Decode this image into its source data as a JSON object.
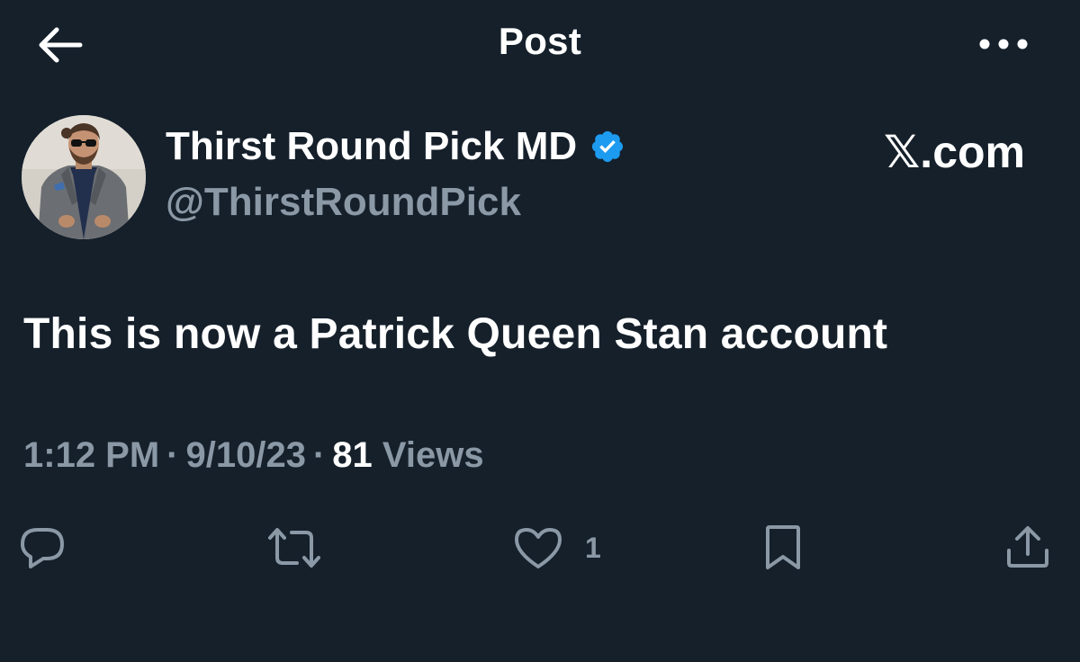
{
  "header": {
    "title": "Post",
    "back_icon": "arrow-left-icon",
    "more_icon": "more-horizontal-icon"
  },
  "author": {
    "name": "Thirst Round Pick MD",
    "handle": "@ThirstRoundPick",
    "verified_icon": "verified-badge-icon",
    "verified_color": "#1d9bf0"
  },
  "watermark": {
    "x_glyph": "𝕏",
    "domain": ".com"
  },
  "post": {
    "text": "This is now a Patrick Queen Stan account",
    "time": "1:12 PM",
    "date": "9/10/23",
    "separator": "·",
    "views_count": "81",
    "views_label": "Views"
  },
  "actions": {
    "reply_icon": "reply-icon",
    "repost_icon": "repost-icon",
    "like_icon": "heart-icon",
    "like_count": "1",
    "bookmark_icon": "bookmark-icon",
    "share_icon": "share-icon"
  },
  "colors": {
    "background": "#15202b",
    "text_primary": "#ffffff",
    "text_secondary": "#8b98a5"
  }
}
